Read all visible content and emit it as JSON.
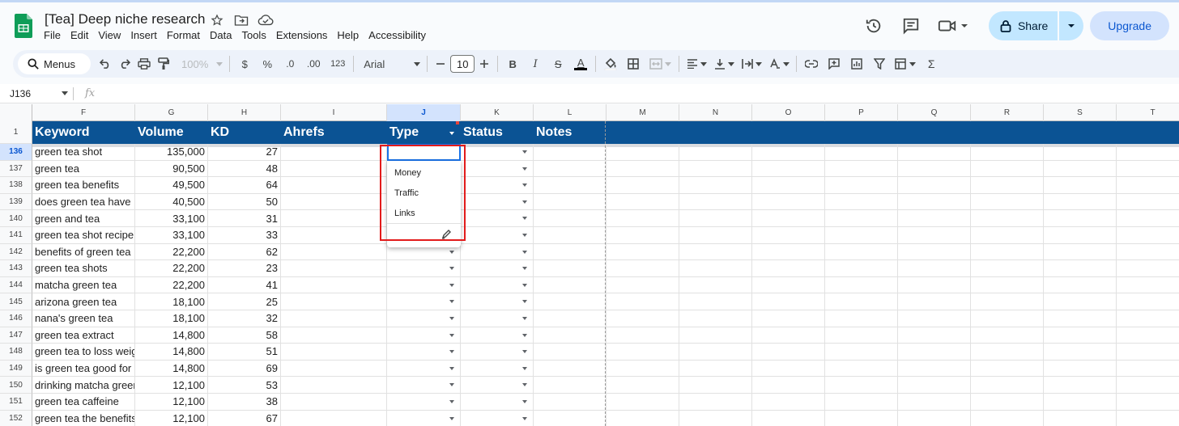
{
  "app": {
    "doc_title": "[Tea] Deep niche research",
    "menus": [
      "File",
      "Edit",
      "View",
      "Insert",
      "Format",
      "Data",
      "Tools",
      "Extensions",
      "Help",
      "Accessibility"
    ],
    "share_label": "Share",
    "upgrade_label": "Upgrade"
  },
  "toolbar": {
    "search_label": "Menus",
    "zoom": "100%",
    "currency": "$",
    "percent": "%",
    "decrease_decimal": ".0",
    "increase_decimal": ".00",
    "number_format": "123",
    "font": "Arial",
    "font_size": "10",
    "bold": "B",
    "italic": "I",
    "strike": "S",
    "text_color": "A",
    "sigma": "Σ"
  },
  "formula_bar": {
    "name_box": "J136",
    "fx": "fx"
  },
  "columns": [
    "F",
    "G",
    "H",
    "I",
    "J",
    "K",
    "L",
    "M",
    "N",
    "O",
    "P",
    "Q",
    "R",
    "S",
    "T"
  ],
  "header_row": {
    "row_number": "1",
    "cells": [
      "Keyword",
      "Volume",
      "KD",
      "Ahrefs",
      "Type",
      "Status",
      "Notes"
    ]
  },
  "rows": [
    {
      "n": "136",
      "keyword": "green tea shot",
      "volume": "135,000",
      "kd": "27"
    },
    {
      "n": "137",
      "keyword": "green tea",
      "volume": "90,500",
      "kd": "48"
    },
    {
      "n": "138",
      "keyword": "green tea benefits",
      "volume": "49,500",
      "kd": "64"
    },
    {
      "n": "139",
      "keyword": "does green tea have",
      "volume": "40,500",
      "kd": "50"
    },
    {
      "n": "140",
      "keyword": "green and tea",
      "volume": "33,100",
      "kd": "31"
    },
    {
      "n": "141",
      "keyword": "green tea shot recipe",
      "volume": "33,100",
      "kd": "33"
    },
    {
      "n": "142",
      "keyword": "benefits of green tea",
      "volume": "22,200",
      "kd": "62"
    },
    {
      "n": "143",
      "keyword": "green tea shots",
      "volume": "22,200",
      "kd": "23"
    },
    {
      "n": "144",
      "keyword": "matcha green tea",
      "volume": "22,200",
      "kd": "41"
    },
    {
      "n": "145",
      "keyword": "arizona green tea",
      "volume": "18,100",
      "kd": "25"
    },
    {
      "n": "146",
      "keyword": "nana's green tea",
      "volume": "18,100",
      "kd": "32"
    },
    {
      "n": "147",
      "keyword": "green tea extract",
      "volume": "14,800",
      "kd": "58"
    },
    {
      "n": "148",
      "keyword": "green tea to loss weight",
      "volume": "14,800",
      "kd": "51"
    },
    {
      "n": "149",
      "keyword": "is green tea good for",
      "volume": "14,800",
      "kd": "69"
    },
    {
      "n": "150",
      "keyword": "drinking matcha green tea",
      "volume": "12,100",
      "kd": "53"
    },
    {
      "n": "151",
      "keyword": "green tea caffeine",
      "volume": "12,100",
      "kd": "38"
    },
    {
      "n": "152",
      "keyword": "green tea the benefits",
      "volume": "12,100",
      "kd": "67"
    }
  ],
  "dropdown": {
    "options": [
      "Money",
      "Traffic",
      "Links"
    ]
  },
  "colors": {
    "header_bg": "#0b5394",
    "selection": "#1a73e8",
    "highlight_box": "#e21b1b",
    "share_bg": "#c2e7ff"
  }
}
